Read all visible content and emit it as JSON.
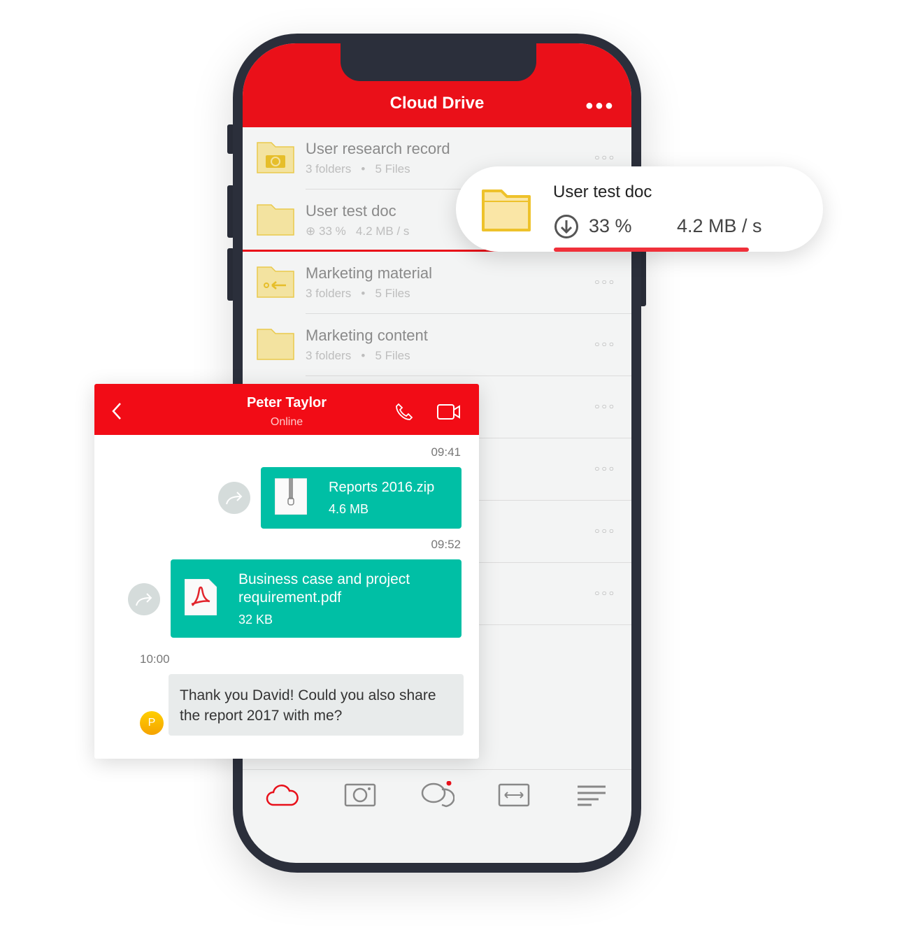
{
  "app": {
    "title": "Cloud Drive",
    "more_icon": "more-horizontal-icon",
    "accent": "#ea1019"
  },
  "files": [
    {
      "name": "User research record",
      "meta": "3 folders   •   5 Files",
      "icon": "folder-camera-icon"
    },
    {
      "name": "User test doc",
      "percent": "33 %",
      "speed": "4.2 MB / s",
      "icon": "folder-icon",
      "progress": 0.33
    },
    {
      "name": "Marketing material",
      "meta": "3 folders   •   5 Files",
      "icon": "folder-share-icon"
    },
    {
      "name": "Marketing content",
      "meta": "3 folders   •   5 Files",
      "icon": "folder-icon"
    }
  ],
  "download_popup": {
    "name": "User test doc",
    "percent": "33 %",
    "speed": "4.2 MB / s",
    "progress": 0.33,
    "bar_color": "#f0303a"
  },
  "tabbar": [
    "cloud-icon",
    "camera-icon",
    "chat-icon",
    "transfer-icon",
    "menu-icon"
  ],
  "chat": {
    "contact": "Peter Taylor",
    "status": "Online",
    "messages": [
      {
        "time": "09:41",
        "file": "Reports 2016.zip",
        "size": "4.6 MB"
      },
      {
        "time": "09:52",
        "file": "Business case and project requirement.pdf",
        "size": "32 KB"
      },
      {
        "time": "10:00",
        "text": "Thank you David! Could you also share the report 2017 with me?",
        "avatar": "P"
      }
    ],
    "bubble_color": "#00bfa5"
  }
}
